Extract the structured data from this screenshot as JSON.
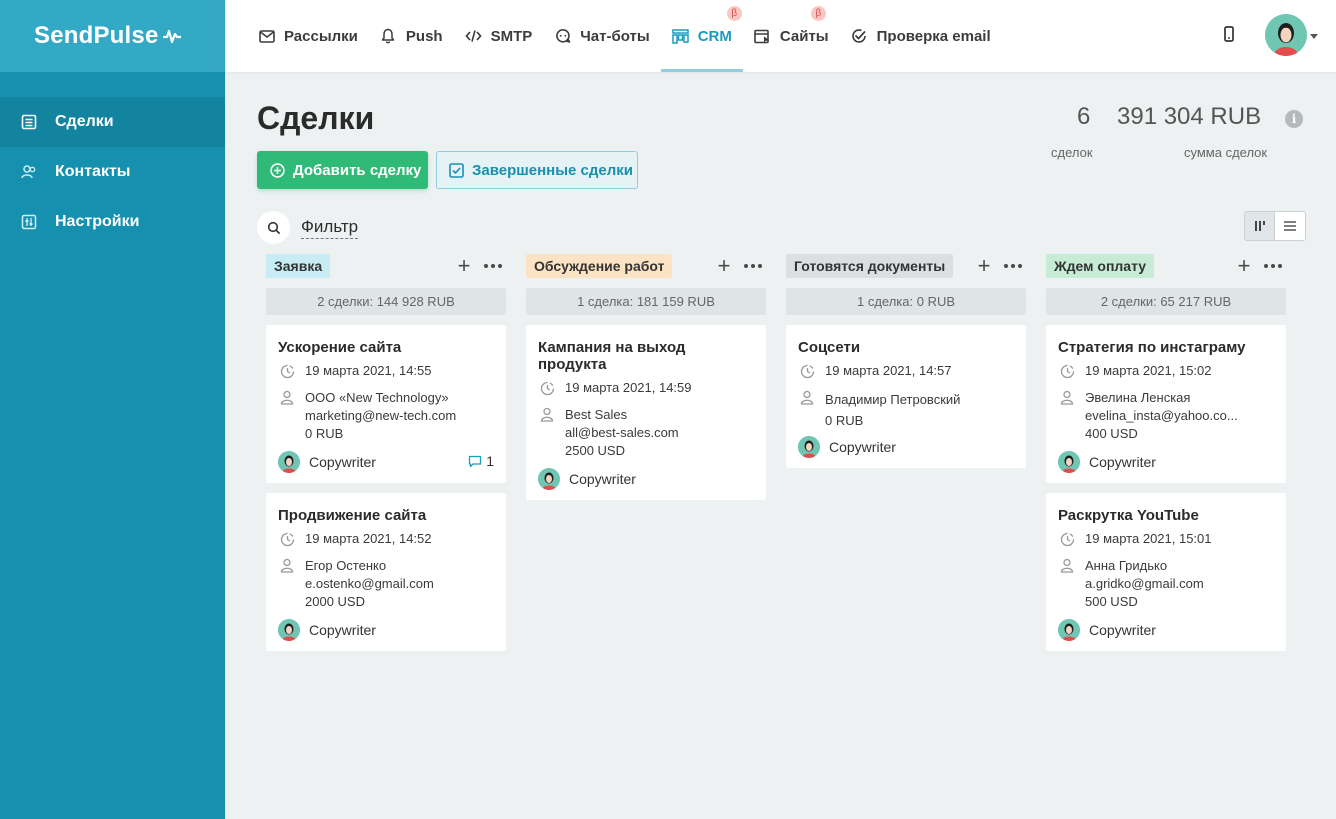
{
  "brand": {
    "name": "SendPulse"
  },
  "sidebar": {
    "items": [
      {
        "label": "Сделки",
        "icon": "deals-icon",
        "active": true
      },
      {
        "label": "Контакты",
        "icon": "contacts-icon",
        "active": false
      },
      {
        "label": "Настройки",
        "icon": "settings-icon",
        "active": false
      }
    ]
  },
  "topnav": {
    "items": [
      {
        "label": "Рассылки",
        "icon": "mail-icon"
      },
      {
        "label": "Push",
        "icon": "bell-icon"
      },
      {
        "label": "SMTP",
        "icon": "code-icon"
      },
      {
        "label": "Чат-боты",
        "icon": "chat-bot-icon"
      },
      {
        "label": "CRM",
        "icon": "crm-icon",
        "active": true,
        "beta": "β"
      },
      {
        "label": "Сайты",
        "icon": "sites-icon",
        "beta": "β"
      },
      {
        "label": "Проверка email",
        "icon": "check-circle-icon"
      }
    ]
  },
  "page": {
    "title": "Сделки",
    "add_button": "Добавить сделку",
    "done_button": "Завершенные сделки",
    "filter_label": "Фильтр"
  },
  "stats": {
    "deals_count": "6",
    "deals_label": "сделок",
    "sum": "391 304 RUB",
    "sum_label": "сумма сделок",
    "info": "i"
  },
  "columns": [
    {
      "stage": "Заявка",
      "color": "#c7ecf3",
      "summary": "2 сделки: 144 928 RUB",
      "cards": [
        {
          "title": "Ускорение сайта",
          "date": "19 марта 2021, 14:55",
          "contact": [
            "ООО «New Technology»",
            "marketing@new-tech.com",
            "0 RUB"
          ],
          "owner": "Copywriter",
          "comments": "1"
        },
        {
          "title": "Продвижение сайта",
          "date": "19 марта 2021, 14:52",
          "contact": [
            "Егор Остенко",
            "e.ostenko@gmail.com",
            "2000 USD"
          ],
          "owner": "Copywriter"
        }
      ]
    },
    {
      "stage": "Обсуждение работ",
      "color": "#fbe3c3",
      "summary": "1 сделка: 181 159 RUB",
      "cards": [
        {
          "title": "Кампания на выход продукта",
          "date": "19 марта 2021, 14:59",
          "contact": [
            "Best Sales",
            "all@best-sales.com",
            "2500 USD"
          ],
          "owner": "Copywriter"
        }
      ]
    },
    {
      "stage": "Готовятся документы",
      "color": "#dcdfe1",
      "summary": "1 сделка: 0 RUB",
      "cards": [
        {
          "title": "Соцсети",
          "date": "19 марта 2021, 14:57",
          "contact": [
            "Владимир Петровский",
            "0 RUB"
          ],
          "owner": "Copywriter"
        }
      ]
    },
    {
      "stage": "Ждем оплату",
      "color": "#c7ecd6",
      "summary": "2 сделки: 65 217 RUB",
      "cards": [
        {
          "title": "Стратегия по инстаграму",
          "date": "19 марта 2021, 15:02",
          "contact": [
            "Эвелина Ленская",
            "evelina_insta@yahoo.co...",
            "400 USD"
          ],
          "owner": "Copywriter"
        },
        {
          "title": "Раскрутка YouTube",
          "date": "19 марта 2021, 15:01",
          "contact": [
            "Анна Гридько",
            "a.gridko@gmail.com",
            "500 USD"
          ],
          "owner": "Copywriter"
        }
      ]
    }
  ]
}
